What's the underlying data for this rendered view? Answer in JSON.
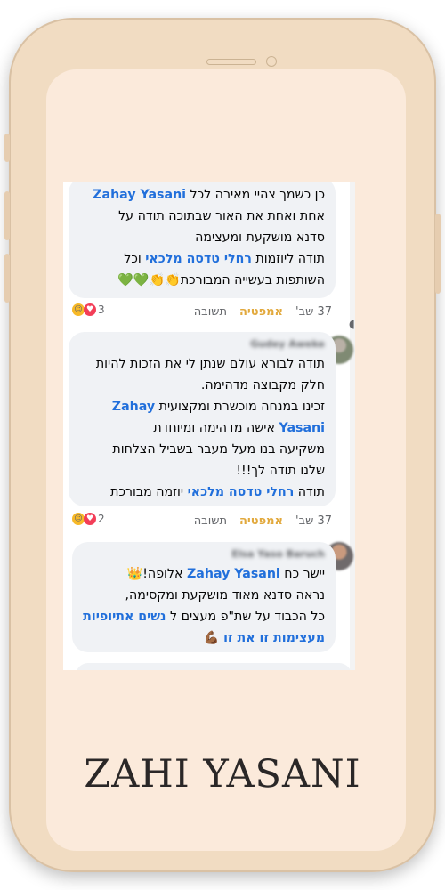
{
  "comments": [
    {
      "author": "",
      "line1_a": "כן כשמך צהיי מאירה לכל ",
      "line1_tag": "Zahay Yasani",
      "line2": "אחת ואחת את האור שבתוכה תודה על",
      "line3": "סדנא מושקעת ומעצימה",
      "line4_a": "תודה ליוזמות ",
      "line4_tag": "רחלי טדסה מלכאי",
      "line4_b": " וכל",
      "line5": "השותפות בעשייה המבורכת👏👏💚💚",
      "time": "37 שב'",
      "like": "אמפטיה",
      "reply": "תשובה",
      "reaction_count": "3"
    },
    {
      "author": "Gudey Aweke",
      "line1": "תודה לבורא עולם שנתן לי את הזכות להיות",
      "line2": "חלק מקבוצה מדהימה.",
      "line3_a": "זכינו במנחה מוכשרת ומקצועית ",
      "line3_tag": "Zahay",
      "line4_tag": "Yasani",
      "line4_b": " אישה מדהימה ומיוחדת",
      "line5": "משקיעה בנו מעל מעבר בשביל הצלחות",
      "line6": "שלנו תודה לך!!!",
      "line7_a": "תודה ",
      "line7_tag": "רחלי טדסה מלכאי",
      "line7_b": " יוזמה מבורכת",
      "time": "37 שב'",
      "like": "אמפטיה",
      "reply": "תשובה",
      "reaction_count": "2"
    },
    {
      "author": "Elsa Yaso Baruch",
      "line1_a": "יישר כח ",
      "line1_tag": "Zahay Yasani",
      "line1_b": " אלופה!👑",
      "line2": "נראה סדנא מאוד מושקעת ומקסימה,",
      "line3_a": "כל הכבוד על שת\"פ מעצים ל ",
      "line3_tag": "נשים אתיופיות",
      "line4_tag": "מעצימות זו את זו",
      "line4_b": " 💪🏾"
    }
  ],
  "brand": "ZAHI YASANI",
  "icons": {
    "sound": "sound-icon",
    "heart": "heart-reaction-icon",
    "hug": "care-reaction-icon"
  }
}
